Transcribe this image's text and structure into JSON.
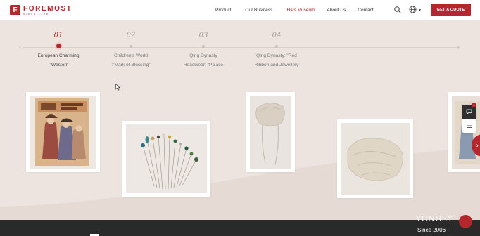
{
  "header": {
    "logo_name": "FOREMOST",
    "logo_sub": "SINCE 1978",
    "nav": [
      "Product",
      "Our Business",
      "Hats Museum",
      "About Us",
      "Contact"
    ],
    "active_nav": "Hats Museum",
    "cta": "GET A QUOTE"
  },
  "timeline": [
    {
      "num": "01",
      "line1": "European Charming",
      "line2": ":\"Western",
      "active": true
    },
    {
      "num": "02",
      "line1": "Children's World",
      "line2": ":\"Mark of Blessing\"",
      "active": false
    },
    {
      "num": "03",
      "line1": "Qing Dynasty",
      "line2": "Headwear: \"Palace",
      "active": false
    },
    {
      "num": "04",
      "line1": "Qing Dynasty: \"Red",
      "line2": "Ribbon and Jewellery",
      "active": false
    }
  ],
  "side_tools": {
    "badge": "1"
  },
  "watermark": {
    "name": "YONGSY",
    "since": "Since 2006"
  },
  "colors": {
    "accent": "#b3272d",
    "background": "#ede4df",
    "footer": "#2a2a2a"
  },
  "icons": [
    "search-icon",
    "globe-icon",
    "chat-icon",
    "list-icon",
    "chevron-right-icon",
    "cursor-icon"
  ]
}
